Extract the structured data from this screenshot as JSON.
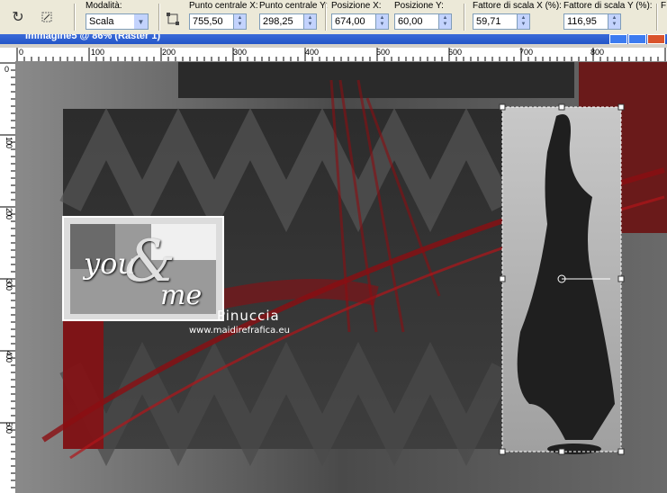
{
  "toolbar": {
    "mode": {
      "label": "Modalità:",
      "value": "Scala"
    },
    "center_x": {
      "label": "Punto centrale X:",
      "value": "755,50"
    },
    "center_y": {
      "label": "Punto centrale Y:",
      "value": "298,25"
    },
    "pos_x": {
      "label": "Posizione X:",
      "value": "674,00"
    },
    "pos_y": {
      "label": "Posizione Y:",
      "value": "60,00"
    },
    "scale_x": {
      "label": "Fattore di scala X (%):",
      "value": "59,71"
    },
    "scale_y": {
      "label": "Fattore di scala Y (%):",
      "value": "116,95"
    },
    "cut_label": "F"
  },
  "window": {
    "title": "Immagine5 @ 86% (Raster 1)"
  },
  "ruler": {
    "h": [
      "0",
      "100",
      "200",
      "300",
      "400",
      "500",
      "600",
      "700",
      "800"
    ],
    "v": [
      "0",
      "100",
      "200",
      "300",
      "400",
      "500"
    ]
  },
  "artwork": {
    "logo_word1": "you",
    "logo_amp": "&",
    "logo_word2": "me",
    "signature": "Pinuccia",
    "website": "www.maidirefrafica.eu"
  },
  "colors": {
    "accent_red": "#8b0e12",
    "dark": "#2a2a2a",
    "selection": "#ffffff"
  }
}
